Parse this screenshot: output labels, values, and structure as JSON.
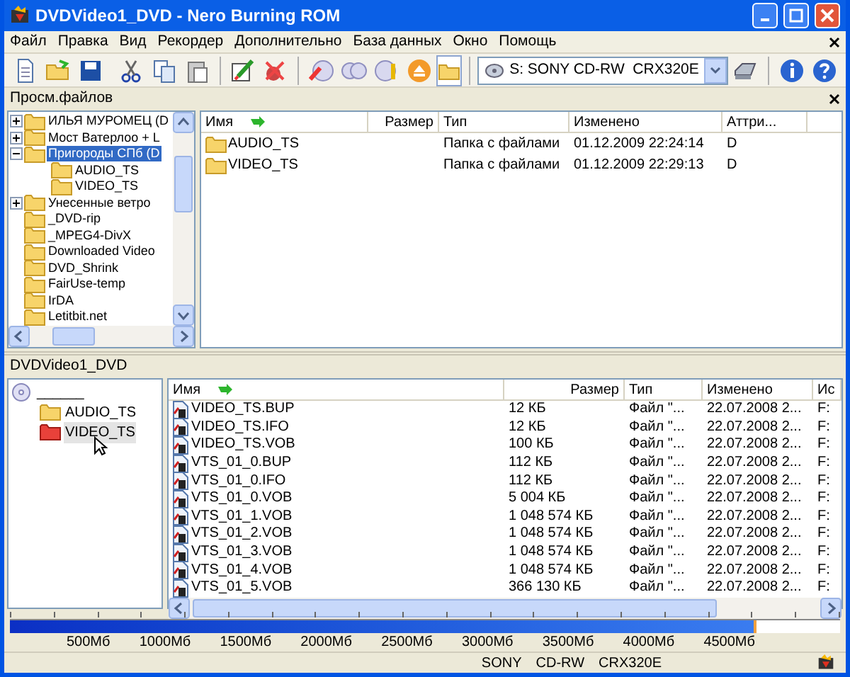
{
  "window": {
    "title": "DVDVideo1_DVD - Nero Burning ROM"
  },
  "menu": [
    "Файл",
    "Правка",
    "Вид",
    "Рекордер",
    "Дополнительно",
    "База данных",
    "Окно",
    "Помощь"
  ],
  "toolbar": {
    "drive": "S: SONY CD-RW  CRX320E"
  },
  "browser": {
    "title": "Просм.файлов",
    "tree": [
      {
        "label": "ИЛЬЯ МУРОМЕЦ (D",
        "kind": "branch",
        "expanded": false,
        "selected": false
      },
      {
        "label": "Мост Ватерлоо + L",
        "kind": "branch",
        "expanded": false,
        "selected": false
      },
      {
        "label": "Пригороды СПб (D",
        "kind": "branch",
        "expanded": true,
        "selected": true,
        "children": [
          {
            "label": "AUDIO_TS",
            "kind": "leaf",
            "selected": false
          },
          {
            "label": "VIDEO_TS",
            "kind": "leaf",
            "selected": false
          }
        ]
      },
      {
        "label": "Унесенные ветро",
        "kind": "branch",
        "expanded": false,
        "selected": false
      },
      {
        "label": "_DVD-rip",
        "kind": "leaf",
        "selected": false
      },
      {
        "label": "_MPEG4-DivX",
        "kind": "leaf",
        "selected": false
      },
      {
        "label": "Downloaded Video",
        "kind": "leaf",
        "selected": false
      },
      {
        "label": "DVD_Shrink",
        "kind": "leaf",
        "selected": false
      },
      {
        "label": "FairUse-temp",
        "kind": "leaf",
        "selected": false
      },
      {
        "label": "IrDA",
        "kind": "leaf",
        "selected": false
      },
      {
        "label": "Letitbit.net",
        "kind": "leaf",
        "selected": false
      }
    ],
    "columns": [
      "Имя",
      "Размер",
      "Тип",
      "Изменено",
      "Аттри..."
    ],
    "rows": [
      {
        "name": "AUDIO_TS",
        "type": "Папка с файлами",
        "modified": "01.12.2009 22:24:14",
        "attributes": "D"
      },
      {
        "name": "VIDEO_TS",
        "type": "Папка с файлами",
        "modified": "01.12.2009 22:29:13",
        "attributes": "D"
      }
    ]
  },
  "compilation": {
    "title": "DVDVideo1_DVD",
    "disc_label": "______",
    "tree": [
      {
        "label": "AUDIO_TS",
        "selected": false
      },
      {
        "label": "VIDEO_TS",
        "selected": true
      }
    ],
    "columns": [
      "Имя",
      "Размер",
      "Тип",
      "Изменено",
      "Ис"
    ],
    "rows": [
      [
        "VIDEO_TS.BUP",
        "12 КБ",
        "Файл \"...",
        "22.07.2008 2...",
        "F:"
      ],
      [
        "VIDEO_TS.IFO",
        "12 КБ",
        "Файл \"...",
        "22.07.2008 2...",
        "F:"
      ],
      [
        "VIDEO_TS.VOB",
        "100 КБ",
        "Файл \"...",
        "22.07.2008 2...",
        "F:"
      ],
      [
        "VTS_01_0.BUP",
        "112 КБ",
        "Файл \"...",
        "22.07.2008 2...",
        "F:"
      ],
      [
        "VTS_01_0.IFO",
        "112 КБ",
        "Файл \"...",
        "22.07.2008 2...",
        "F:"
      ],
      [
        "VTS_01_0.VOB",
        "5 004 КБ",
        "Файл \"...",
        "22.07.2008 2...",
        "F:"
      ],
      [
        "VTS_01_1.VOB",
        "1 048 574 КБ",
        "Файл \"...",
        "22.07.2008 2...",
        "F:"
      ],
      [
        "VTS_01_2.VOB",
        "1 048 574 КБ",
        "Файл \"...",
        "22.07.2008 2...",
        "F:"
      ],
      [
        "VTS_01_3.VOB",
        "1 048 574 КБ",
        "Файл \"...",
        "22.07.2008 2...",
        "F:"
      ],
      [
        "VTS_01_4.VOB",
        "1 048 574 КБ",
        "Файл \"...",
        "22.07.2008 2...",
        "F:"
      ],
      [
        "VTS_01_5.VOB",
        "366 130 КБ",
        "Файл \"...",
        "22.07.2008 2...",
        "F:"
      ]
    ]
  },
  "capacity": {
    "level": 0.9,
    "ticks": [
      "500Мб",
      "1000Мб",
      "1500Мб",
      "2000Мб",
      "2500Мб",
      "3000Мб",
      "3500Мб",
      "4000Мб",
      "4500Мб"
    ]
  },
  "status_bar": [
    "SONY",
    "CD-RW",
    "CRX320E"
  ]
}
